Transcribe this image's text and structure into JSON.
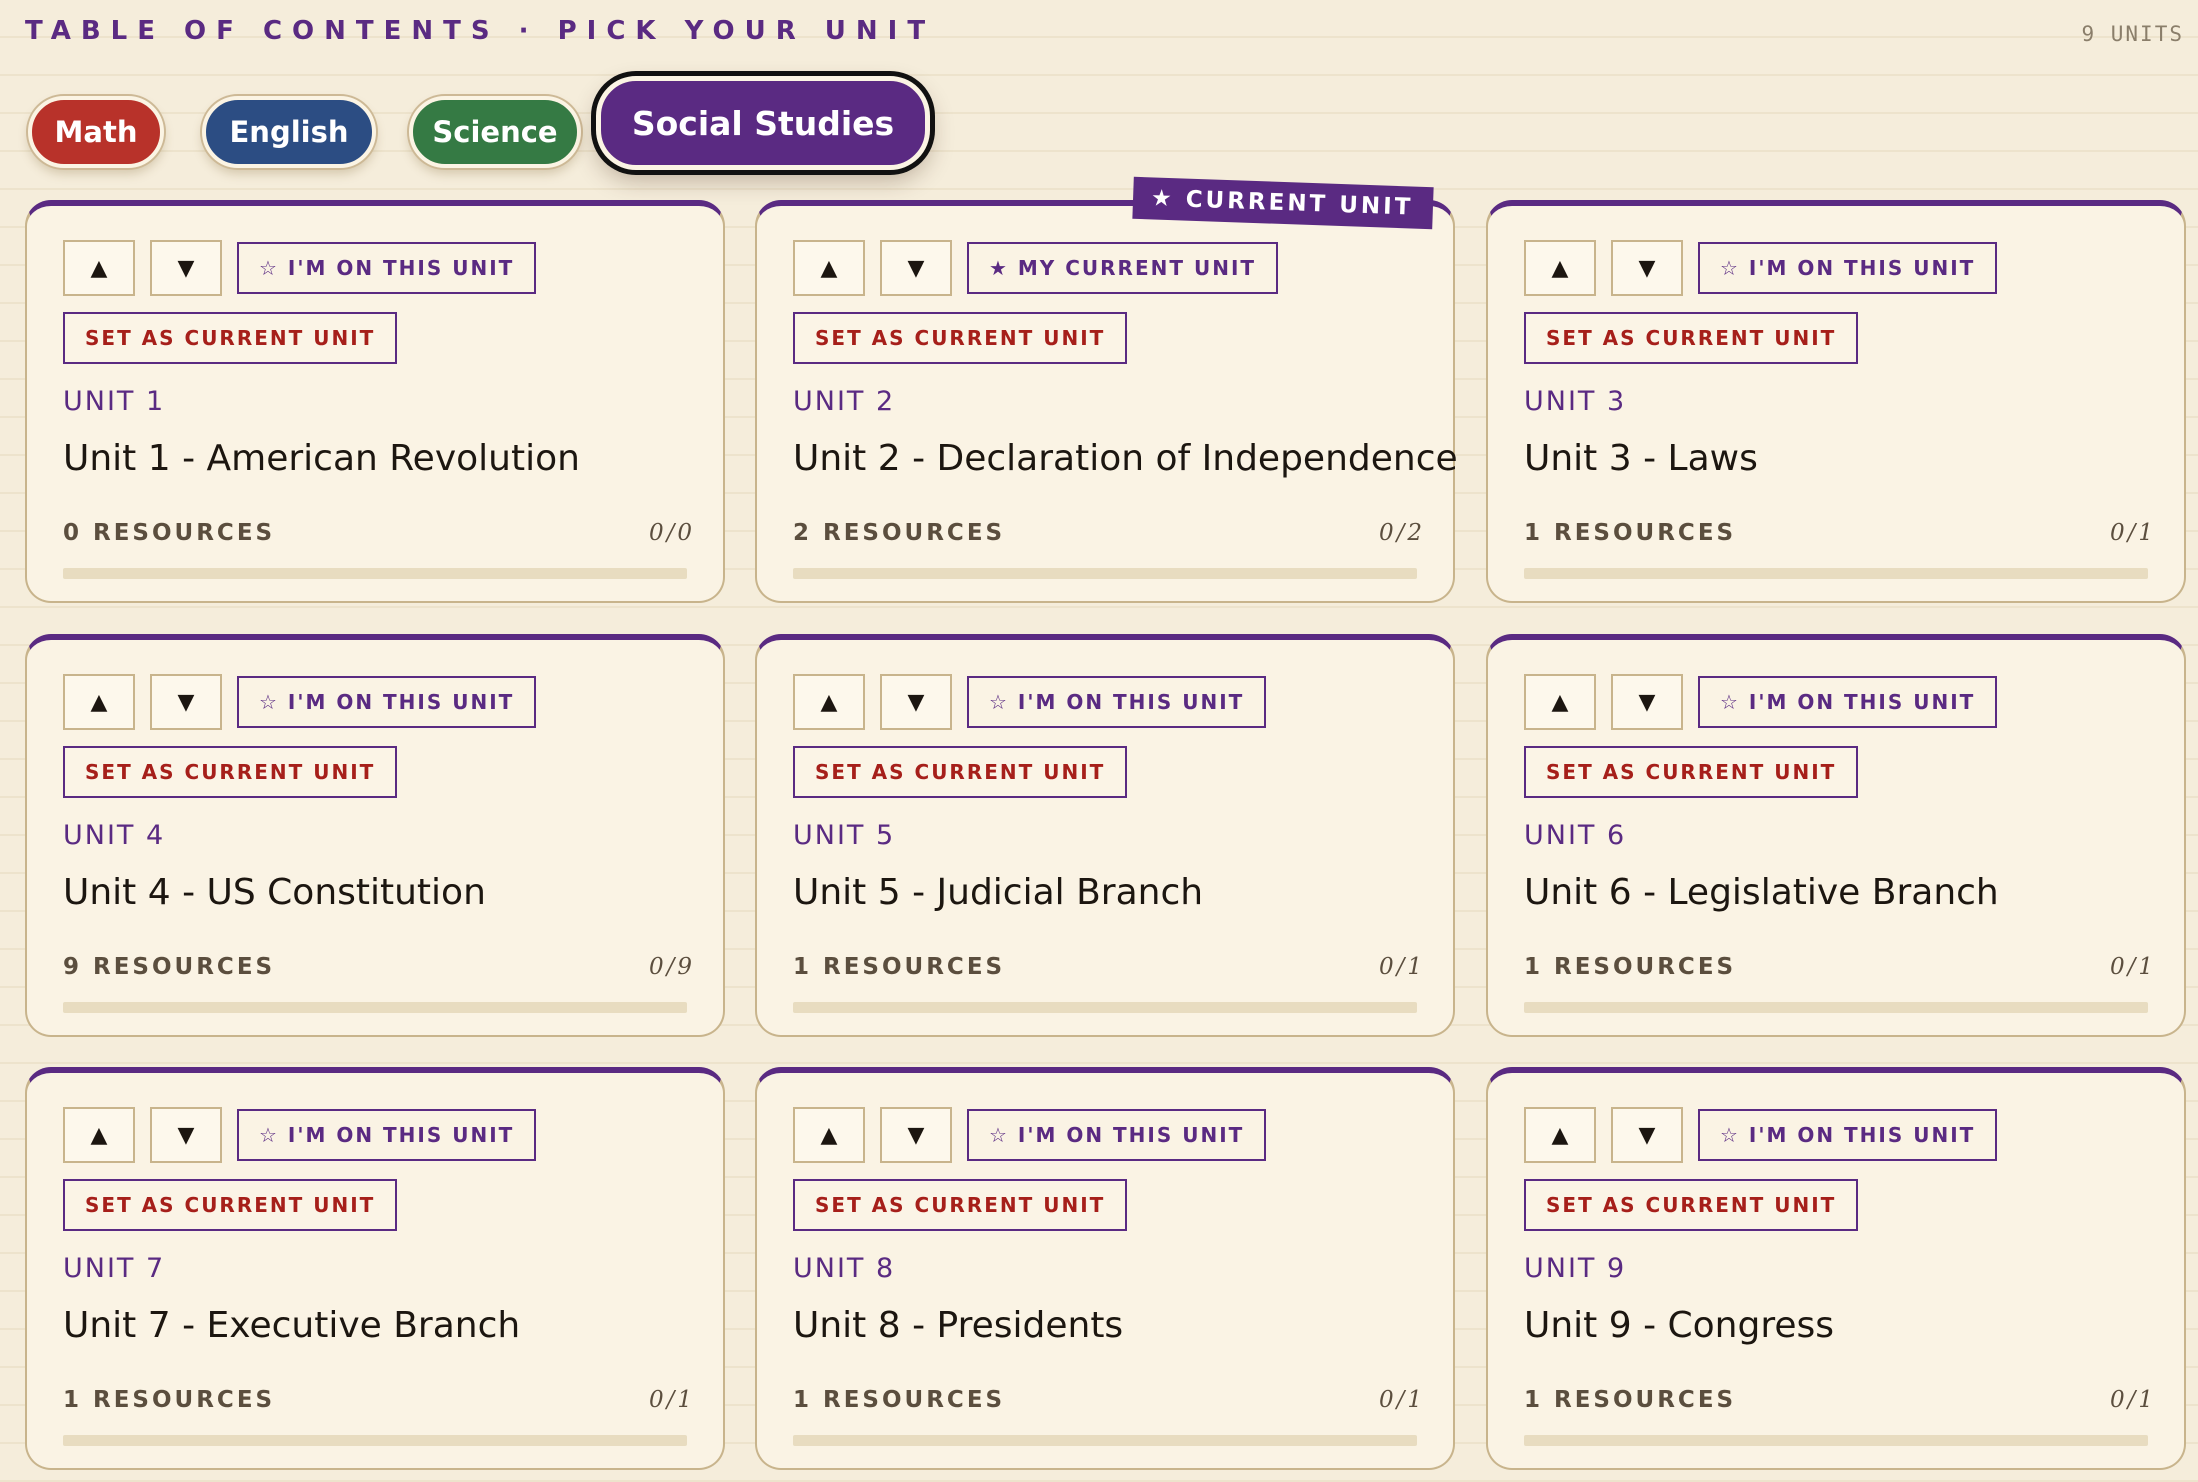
{
  "header": {
    "title": "TABLE OF CONTENTS · PICK YOUR UNIT",
    "unit_count": "9 UNITS"
  },
  "colors": {
    "accent": "#5a2a82",
    "math": "#b8322a",
    "english": "#2c4d83",
    "science": "#357a44",
    "social_studies": "#5a2a82",
    "set_current_text": "#a61f1a"
  },
  "tabs": [
    {
      "label": "Math",
      "color": "#b8322a",
      "active": false
    },
    {
      "label": "English",
      "color": "#2c4d83",
      "active": false
    },
    {
      "label": "Science",
      "color": "#357a44",
      "active": false
    },
    {
      "label": "Social Studies",
      "color": "#5a2a82",
      "active": true
    }
  ],
  "current_ribbon": "★ CURRENT UNIT",
  "set_current_label": "SET AS CURRENT UNIT",
  "icons": {
    "up": "▲",
    "down": "▼"
  },
  "units": [
    {
      "label": "UNIT 1",
      "name": "Unit 1 - American Revolution",
      "resources": "0 RESOURCES",
      "ratio": "0/0",
      "progress": 0,
      "mark": "☆ I'M ON THIS UNIT",
      "current": false
    },
    {
      "label": "UNIT 2",
      "name": "Unit 2 - Declaration of Independence",
      "resources": "2 RESOURCES",
      "ratio": "0/2",
      "progress": 0,
      "mark": "★ MY CURRENT UNIT",
      "current": true
    },
    {
      "label": "UNIT 3",
      "name": "Unit 3 - Laws",
      "resources": "1 RESOURCES",
      "ratio": "0/1",
      "progress": 0,
      "mark": "☆ I'M ON THIS UNIT",
      "current": false
    },
    {
      "label": "UNIT 4",
      "name": "Unit 4 - US Constitution",
      "resources": "9 RESOURCES",
      "ratio": "0/9",
      "progress": 0,
      "mark": "☆ I'M ON THIS UNIT",
      "current": false
    },
    {
      "label": "UNIT 5",
      "name": "Unit 5 - Judicial Branch",
      "resources": "1 RESOURCES",
      "ratio": "0/1",
      "progress": 0,
      "mark": "☆ I'M ON THIS UNIT",
      "current": false
    },
    {
      "label": "UNIT 6",
      "name": "Unit 6 - Legislative Branch",
      "resources": "1 RESOURCES",
      "ratio": "0/1",
      "progress": 0,
      "mark": "☆ I'M ON THIS UNIT",
      "current": false
    },
    {
      "label": "UNIT 7",
      "name": "Unit 7 - Executive Branch",
      "resources": "1 RESOURCES",
      "ratio": "0/1",
      "progress": 0,
      "mark": "☆ I'M ON THIS UNIT",
      "current": false
    },
    {
      "label": "UNIT 8",
      "name": "Unit 8 - Presidents",
      "resources": "1 RESOURCES",
      "ratio": "0/1",
      "progress": 0,
      "mark": "☆ I'M ON THIS UNIT",
      "current": false
    },
    {
      "label": "UNIT 9",
      "name": "Unit 9 - Congress",
      "resources": "1 RESOURCES",
      "ratio": "0/1",
      "progress": 0,
      "mark": "☆ I'M ON THIS UNIT",
      "current": false
    }
  ]
}
